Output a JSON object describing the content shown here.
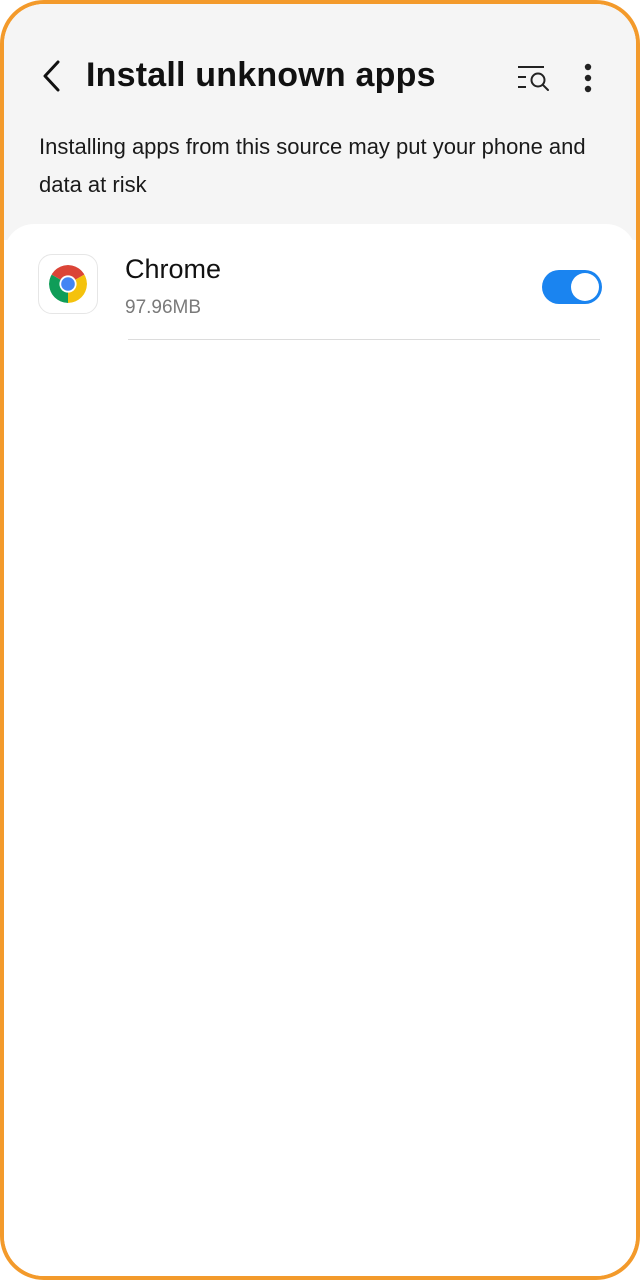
{
  "header": {
    "title": "Install unknown apps",
    "back_icon": "chevron-left-icon",
    "search_icon": "list-search-icon",
    "more_icon": "more-vertical-icon"
  },
  "warning": {
    "text": "Installing apps from this source may put your phone and data at risk"
  },
  "apps": [
    {
      "name": "Chrome",
      "size": "97.96MB",
      "icon": "chrome-icon",
      "allowed": true
    }
  ],
  "colors": {
    "accent": "#1a84f0",
    "frame": "#f39a2b",
    "top_background": "#f5f5f5"
  }
}
